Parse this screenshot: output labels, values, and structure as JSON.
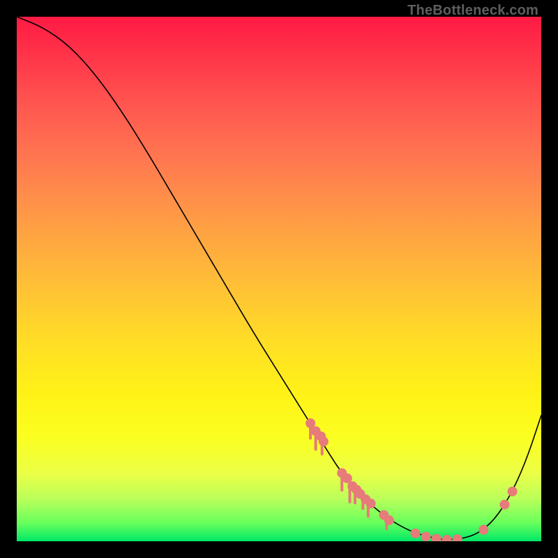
{
  "watermark": "TheBottleneck.com",
  "colors": {
    "dot": "#e77a7a",
    "line": "#000000"
  },
  "chart_data": {
    "type": "line",
    "title": "",
    "subtitle": "",
    "xlabel": "",
    "ylabel": "",
    "xlim": [
      0,
      100
    ],
    "ylim": [
      0,
      100
    ],
    "grid": false,
    "legendpos": "none",
    "series": [
      {
        "name": "curve",
        "x": [
          0,
          5,
          10,
          15,
          20,
          25,
          30,
          35,
          40,
          45,
          50,
          55,
          60,
          62,
          65,
          68,
          72,
          76,
          80,
          82,
          85,
          88,
          91,
          94,
          97,
          100
        ],
        "y": [
          100,
          98,
          94.5,
          89,
          82,
          74,
          65.5,
          57,
          48.5,
          40,
          32,
          24,
          16,
          13,
          9.5,
          6.5,
          3.5,
          1.5,
          0.5,
          0.3,
          0.5,
          1.5,
          4,
          8.5,
          15,
          24
        ]
      }
    ],
    "dots": [
      {
        "x": 56,
        "y": 22.5
      },
      {
        "x": 57,
        "y": 21
      },
      {
        "x": 58,
        "y": 20
      },
      {
        "x": 58.5,
        "y": 19
      },
      {
        "x": 62,
        "y": 13
      },
      {
        "x": 63,
        "y": 12
      },
      {
        "x": 64,
        "y": 10.5
      },
      {
        "x": 64.8,
        "y": 9.8
      },
      {
        "x": 65.5,
        "y": 9
      },
      {
        "x": 66.5,
        "y": 8
      },
      {
        "x": 67.5,
        "y": 7.2
      },
      {
        "x": 70,
        "y": 5
      },
      {
        "x": 71,
        "y": 4
      },
      {
        "x": 76,
        "y": 1.5
      },
      {
        "x": 78,
        "y": 0.9
      },
      {
        "x": 80,
        "y": 0.5
      },
      {
        "x": 82,
        "y": 0.3
      },
      {
        "x": 84,
        "y": 0.4
      },
      {
        "x": 89,
        "y": 2.2
      },
      {
        "x": 93,
        "y": 7
      },
      {
        "x": 94.5,
        "y": 9.5
      }
    ],
    "ticks_under_dots": [
      {
        "x": 56,
        "len": 2.5
      },
      {
        "x": 57,
        "len": 3
      },
      {
        "x": 58.2,
        "len": 2
      },
      {
        "x": 62,
        "len": 3
      },
      {
        "x": 63.5,
        "len": 3.5
      },
      {
        "x": 64.5,
        "len": 2.5
      },
      {
        "x": 66,
        "len": 2
      },
      {
        "x": 67,
        "len": 2.5
      },
      {
        "x": 70.5,
        "len": 2
      }
    ]
  }
}
